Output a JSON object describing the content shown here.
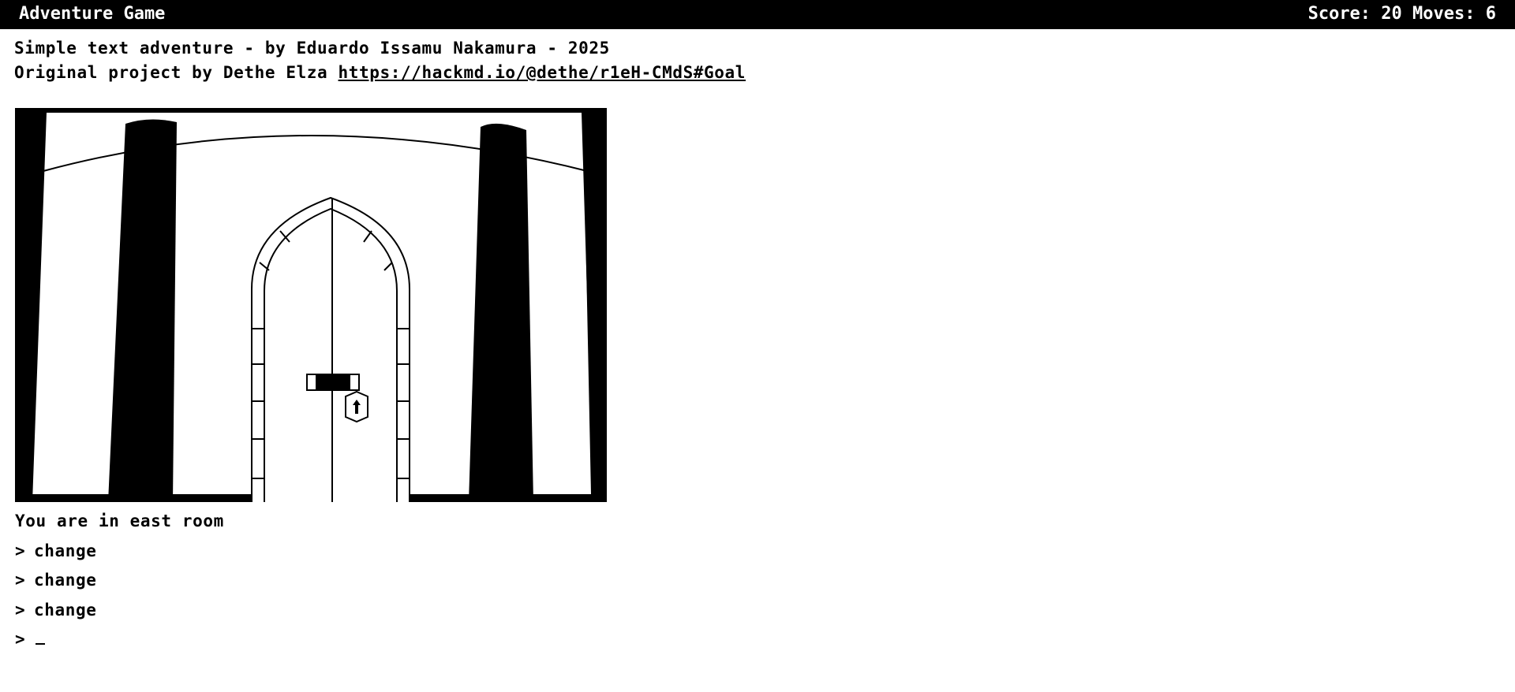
{
  "header": {
    "title": "Adventure Game",
    "status": "Score: 20 Moves: 6"
  },
  "credits": {
    "line1": "Simple text adventure - by Eduardo Issamu Nakamura - 2025",
    "line2_prefix": "Original project by Dethe Elza ",
    "link_text": "https://hackmd.io/@dethe/r1eH-CMdS#Goal"
  },
  "scene": {
    "description": "You are in east room"
  },
  "log": {
    "prompt_symbol": ">",
    "commands": [
      "change",
      "change",
      "change"
    ]
  },
  "input": {
    "value": ""
  }
}
